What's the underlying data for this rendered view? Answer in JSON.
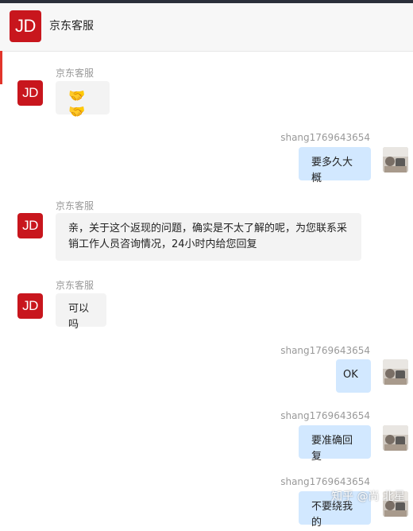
{
  "header": {
    "avatar_text": "JD",
    "title": "京东客服"
  },
  "messages": [
    {
      "side": "left",
      "sender": "京东客服",
      "avatar_text": "JD",
      "text": "🤝🤝"
    },
    {
      "side": "right",
      "sender": "shang1769643654",
      "avatar_icon": "user-photo-avatar",
      "text": "要多久大概"
    },
    {
      "side": "left",
      "sender": "京东客服",
      "avatar_text": "JD",
      "text": "亲，关于这个返现的问题，确实是不太了解的呢，为您联系采销工作人员咨询情况，24小时内给您回复"
    },
    {
      "side": "left",
      "sender": "京东客服",
      "avatar_text": "JD",
      "text": "可以吗"
    },
    {
      "side": "right",
      "sender": "shang1769643654",
      "avatar_icon": "user-photo-avatar",
      "text": "OK"
    },
    {
      "side": "right",
      "sender": "shang1769643654",
      "avatar_icon": "user-photo-avatar",
      "text": "要准确回复"
    },
    {
      "side": "right",
      "sender": "shang1769643654",
      "avatar_icon": "user-photo-avatar",
      "text": "不要绕我的"
    }
  ],
  "watermark": "知乎 @尚 北星",
  "colors": {
    "jd_red": "#c8161d",
    "right_bubble": "#d2e8ff",
    "left_bubble": "#f3f3f3"
  }
}
